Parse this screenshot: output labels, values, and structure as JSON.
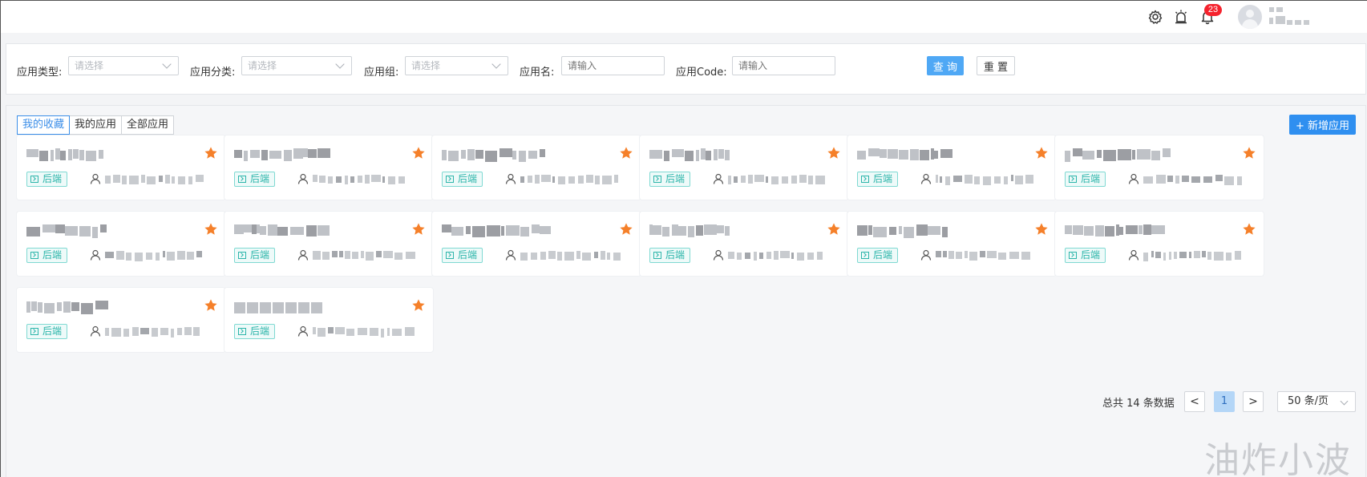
{
  "header": {
    "notification_count": "23",
    "icons": [
      "gear-icon",
      "alarm-icon",
      "bell-icon"
    ]
  },
  "filters": {
    "app_type_label": "应用类型:",
    "app_type_placeholder": "请选择",
    "app_category_label": "应用分类:",
    "app_category_placeholder": "请选择",
    "app_group_label": "应用组:",
    "app_group_placeholder": "请选择",
    "app_name_label": "应用名:",
    "app_name_placeholder": "请输入",
    "app_code_label": "应用Code:",
    "app_code_placeholder": "请输入",
    "query_button": "查 询",
    "reset_button": "重 置"
  },
  "tabs": [
    {
      "label": "我的收藏",
      "active": true
    },
    {
      "label": "我的应用",
      "active": false
    },
    {
      "label": "全部应用",
      "active": false
    }
  ],
  "add_button": "+ 新增应用",
  "cards": [
    {
      "tag": "后端",
      "favorited": true
    },
    {
      "tag": "后端",
      "favorited": true
    },
    {
      "tag": "后端",
      "favorited": true
    },
    {
      "tag": "后端",
      "favorited": true
    },
    {
      "tag": "后端",
      "favorited": true
    },
    {
      "tag": "后端",
      "favorited": true
    },
    {
      "tag": "后端",
      "favorited": true
    },
    {
      "tag": "后端",
      "favorited": true
    },
    {
      "tag": "后端",
      "favorited": true
    },
    {
      "tag": "后端",
      "favorited": true
    },
    {
      "tag": "后端",
      "favorited": true
    },
    {
      "tag": "后端",
      "favorited": true
    },
    {
      "tag": "后端",
      "favorited": true
    },
    {
      "tag": "后端",
      "favorited": true
    }
  ],
  "pagination": {
    "total_text": "总共 14 条数据",
    "prev": "<",
    "current_page": "1",
    "next": ">",
    "page_size": "50 条/页"
  },
  "watermark": "油炸小波",
  "colors": {
    "primary": "#2f8ff0",
    "star": "#f5802a",
    "tag": "#2cb5aa",
    "badge": "#f5222d"
  }
}
